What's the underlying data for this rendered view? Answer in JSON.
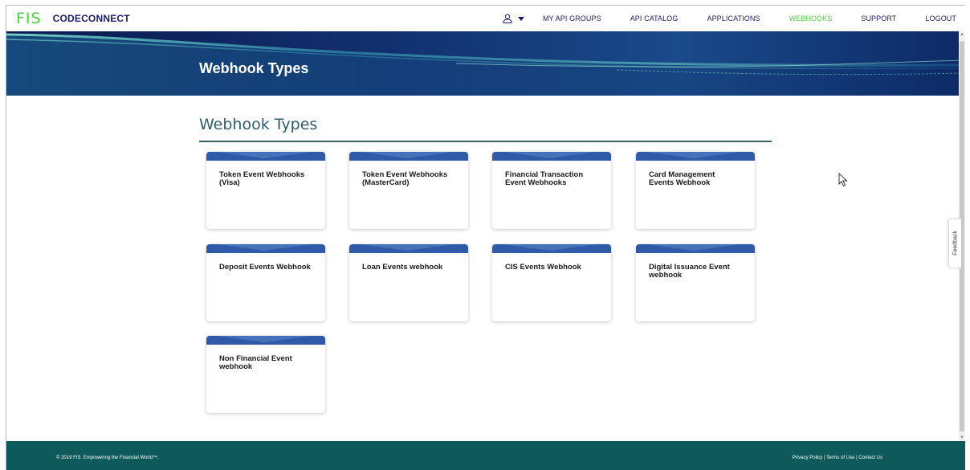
{
  "app": {
    "logo_text": "FIS",
    "brand": "CODECONNECT"
  },
  "nav": {
    "items": [
      {
        "label": "MY API GROUPS",
        "active": false
      },
      {
        "label": "API CATALOG",
        "active": false
      },
      {
        "label": "APPLICATIONS",
        "active": false
      },
      {
        "label": "WEBHOOKS",
        "active": true
      },
      {
        "label": "SUPPORT",
        "active": false
      },
      {
        "label": "LOGOUT",
        "active": false
      }
    ],
    "user_icon": "user-icon",
    "active_color": "#4bcd3e"
  },
  "banner": {
    "title": "Webhook Types"
  },
  "main": {
    "section_title": "Webhook Types",
    "cards": [
      {
        "label": "Token Event Webhooks (Visa)"
      },
      {
        "label": "Token Event Webhooks (MasterCard)"
      },
      {
        "label": "Financial Transaction Event Webhooks"
      },
      {
        "label": "Card Management Events Webhook"
      },
      {
        "label": "Deposit Events Webhook"
      },
      {
        "label": "Loan Events webhook"
      },
      {
        "label": "CIS Events Webhook"
      },
      {
        "label": "Digital Issuance Event webhook"
      },
      {
        "label": "Non Financial Event webhook"
      }
    ]
  },
  "feedback": {
    "label": "Feedback"
  },
  "footer": {
    "copyright": "© 2019 FIS. Empowering the Financial World™.",
    "links": [
      "Privacy Policy",
      "Terms of Use",
      "Contact Us"
    ]
  },
  "colors": {
    "brand_navy": "#1b1b6f",
    "brand_green": "#4bcd3e",
    "card_header": "#2e5aa7",
    "footer_bg": "#0e5a5a",
    "section_title": "#2f5c6e"
  }
}
